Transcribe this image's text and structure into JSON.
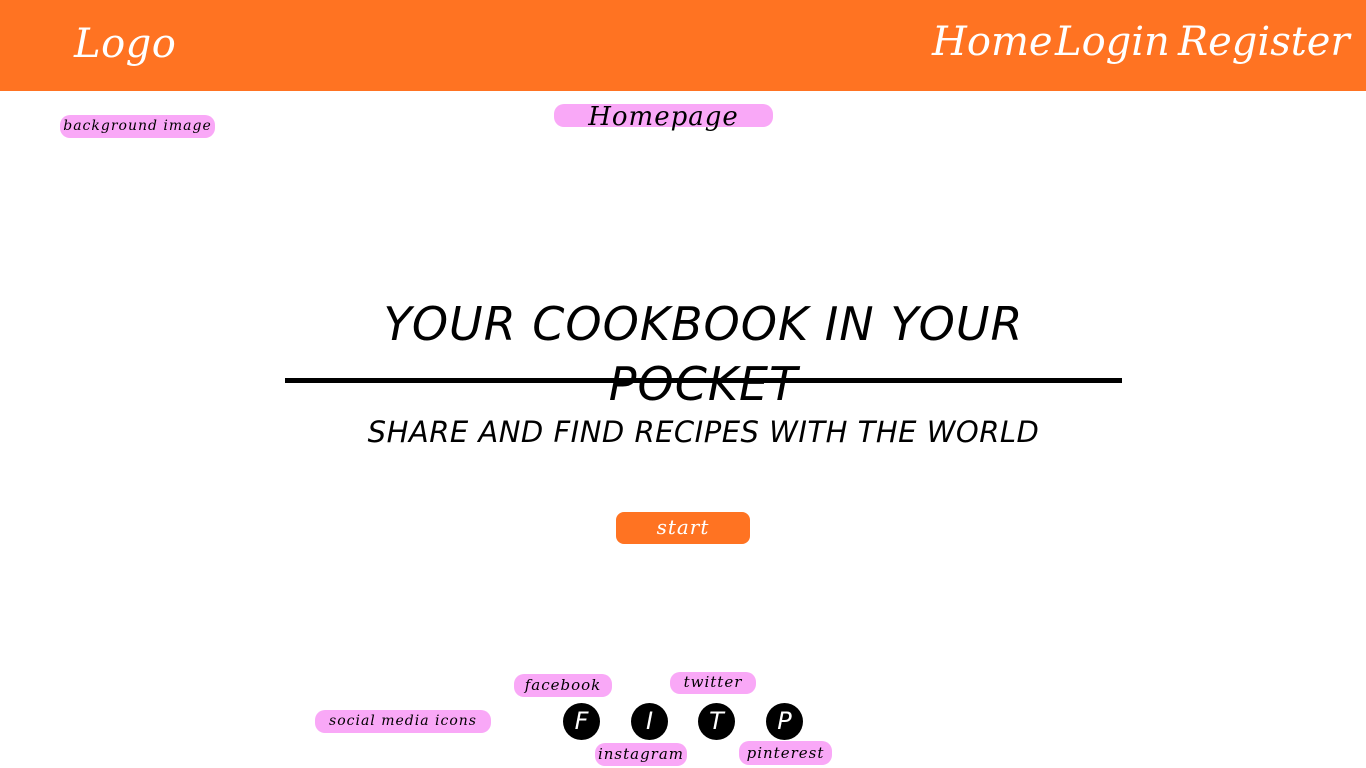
{
  "header": {
    "logo": "Logo",
    "nav": {
      "home": "Home",
      "login": "Login",
      "register": "Register"
    },
    "background_color": "#FF7322"
  },
  "annotations": {
    "background_image": "background image",
    "homepage": "Homepage",
    "social_media_icons": "social media icons",
    "facebook": "facebook",
    "twitter": "twitter",
    "instagram": "instagram",
    "pinterest": "pinterest",
    "highlight_color": "#F9A8F7"
  },
  "hero": {
    "title": "YOUR COOKBOOK IN YOUR POCKET",
    "subtitle": "SHARE AND FIND RECIPES WITH THE WORLD",
    "start_label": "start"
  },
  "social": {
    "icons": [
      {
        "letter": "F",
        "icon": "facebook-icon"
      },
      {
        "letter": "I",
        "icon": "instagram-icon"
      },
      {
        "letter": "T",
        "icon": "twitter-icon"
      },
      {
        "letter": "P",
        "icon": "pinterest-icon"
      }
    ]
  },
  "accent_color": "#FF7322"
}
